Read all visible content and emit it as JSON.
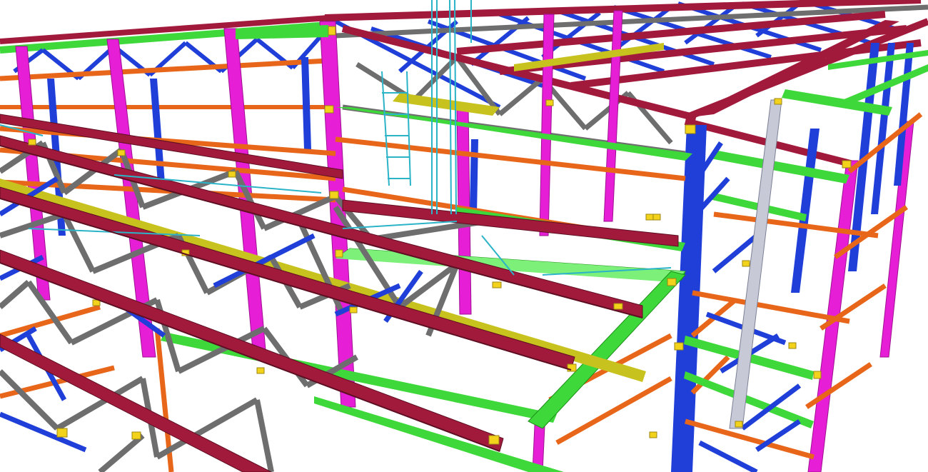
{
  "scene": {
    "description_visible_text": "",
    "member_colors": {
      "truss_chord": "#a11a3c",
      "truss_web": "#6e6e6e",
      "bracing_blue": "#1f3fd8",
      "column_magenta": "#e61fd6",
      "girt_orange": "#e8661a",
      "beam_green": "#3ed83a",
      "deck_yellow": "#c8c21e",
      "tie_cyan": "#2bb3c8",
      "connection_plate": "#f2d21a"
    }
  }
}
